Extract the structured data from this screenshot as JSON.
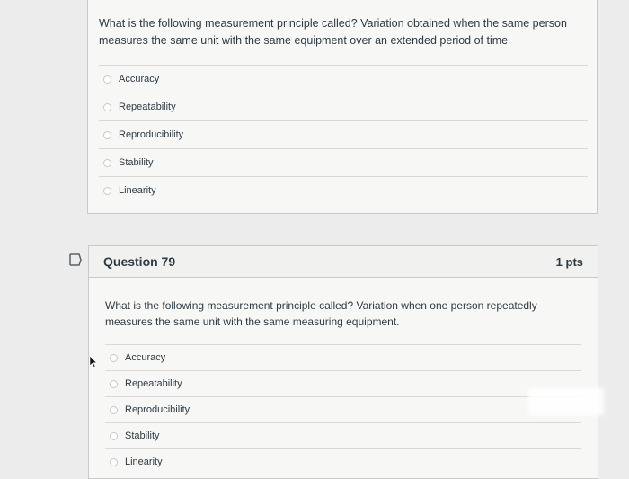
{
  "question_78": {
    "text": "What is the following measurement principle called? Variation obtained when the same person measures the same unit with the same equipment over an extended period of time",
    "options": [
      {
        "label": "Accuracy"
      },
      {
        "label": "Repeatability"
      },
      {
        "label": "Reproducibility"
      },
      {
        "label": "Stability"
      },
      {
        "label": "Linearity"
      }
    ]
  },
  "question_79": {
    "title": "Question 79",
    "points": "1 pts",
    "text": "What is the following measurement principle called? Variation when one person repeatedly measures the same unit with the same measuring equipment.",
    "options": [
      {
        "label": "Accuracy"
      },
      {
        "label": "Repeatability"
      },
      {
        "label": "Reproducibility"
      },
      {
        "label": "Stability"
      },
      {
        "label": "Linearity"
      }
    ]
  },
  "icons": {
    "flag": "flag-question-icon",
    "cursor": "mouse-pointer-icon"
  }
}
